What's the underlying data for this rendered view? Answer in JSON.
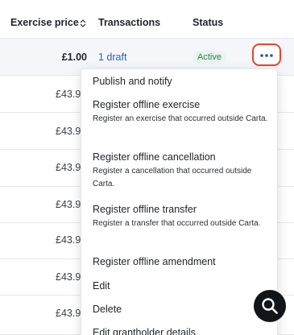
{
  "table": {
    "columns": {
      "exercise_price": "Exercise price",
      "transactions": "Transactions",
      "status": "Status"
    },
    "first_row": {
      "price": "£1.00",
      "transactions": "1 draft",
      "status": "Active"
    },
    "other_prices": [
      "£43.9",
      "£43.9",
      "£43.9",
      "£43.9",
      "£43.9",
      "£43.9",
      "£43.9"
    ]
  },
  "menu": {
    "items": [
      {
        "title": "Publish and notify"
      },
      {
        "title": "Register offline exercise",
        "desc": "Register an exercise that occurred outside Carta."
      },
      {
        "title": "Register offline cancellation",
        "desc": "Register a cancellation that occurred outside Carta."
      },
      {
        "title": "Register offline transfer",
        "desc": "Register a transfer that occurred outside Carta."
      },
      {
        "title": "Register offline amendment"
      },
      {
        "title": "Edit"
      },
      {
        "title": "Delete"
      },
      {
        "title": "Edit grantholder details"
      }
    ]
  },
  "icons": {
    "sort": "sort-icon",
    "more": "more-dots-icon",
    "search": "search-icon"
  },
  "colors": {
    "link": "#2c5fb8",
    "active_badge_bg": "#eaf4ee",
    "active_badge_text": "#2f7d4e",
    "focus_ring": "#e8452b",
    "fab": "#111418"
  }
}
